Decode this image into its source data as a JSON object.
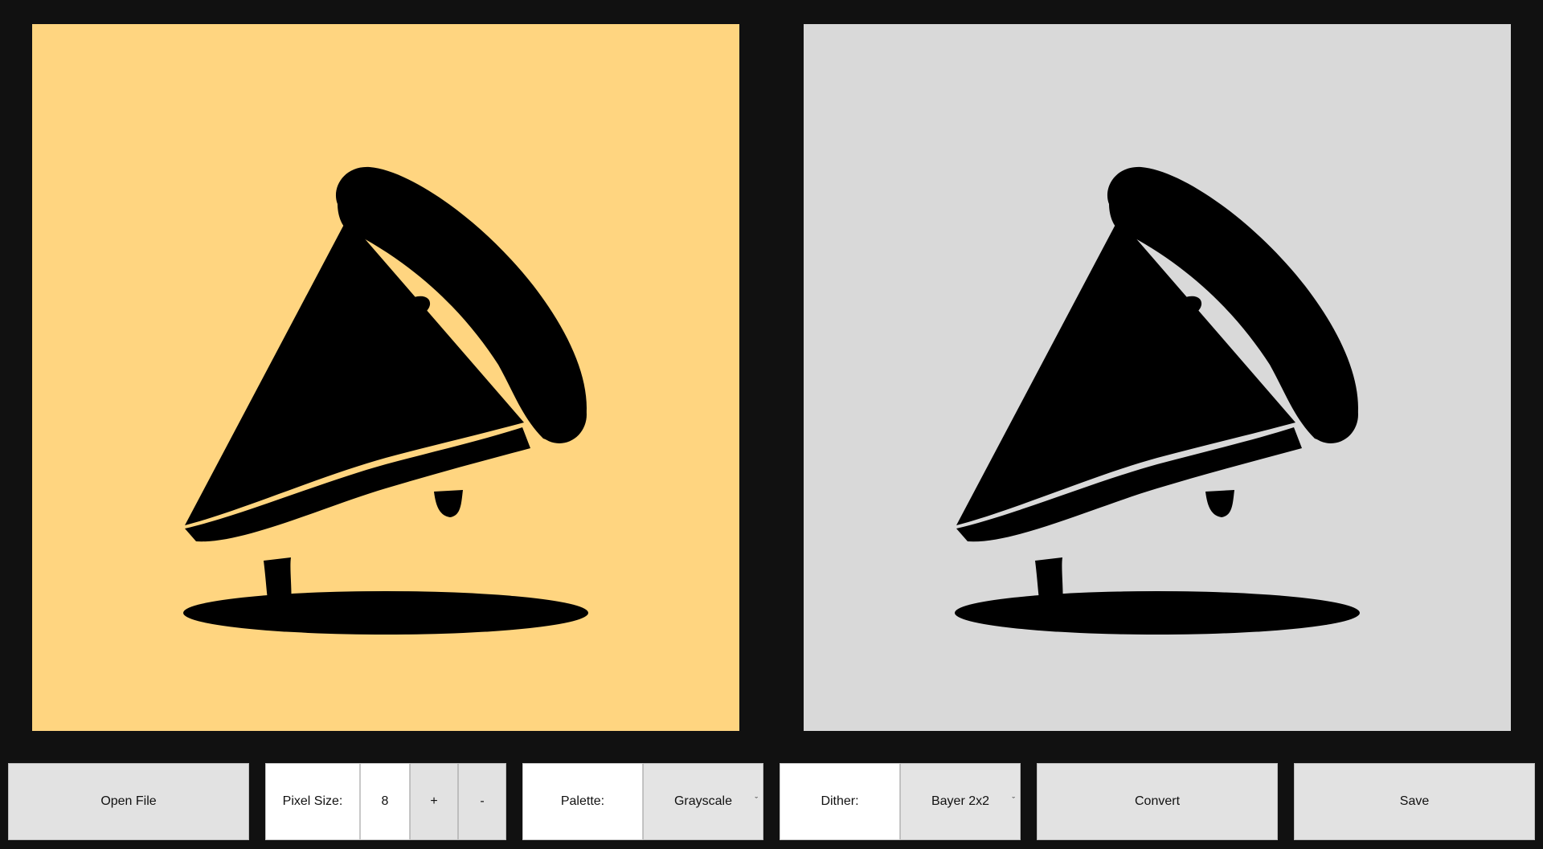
{
  "toolbar": {
    "open_file_label": "Open File",
    "pixel_size_label": "Pixel Size:",
    "pixel_size_value": "8",
    "increment_label": "+",
    "decrement_label": "-",
    "palette_label": "Palette:",
    "palette_value": "Grayscale",
    "dither_label": "Dither:",
    "dither_value": "Bayer 2x2",
    "convert_label": "Convert",
    "save_label": "Save"
  },
  "colors": {
    "source_background": "#ffd580",
    "output_background": "#d9d9d9",
    "window_background": "#111111"
  },
  "icons": {
    "dropdown": "chevron-down-icon"
  }
}
